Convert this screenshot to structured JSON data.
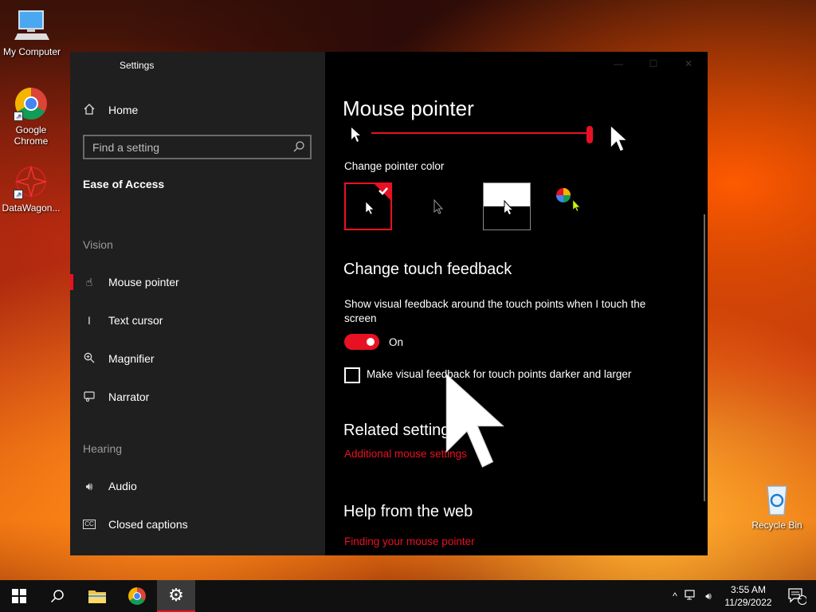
{
  "desktop": {
    "icons": [
      {
        "label": "My Computer"
      },
      {
        "label": "Google Chrome"
      },
      {
        "label": "DataWagon..."
      },
      {
        "label": "Recycle Bin"
      }
    ]
  },
  "window": {
    "title": "Settings",
    "sidebar": {
      "home": "Home",
      "search_placeholder": "Find a setting",
      "category": "Ease of Access",
      "vision_label": "Vision",
      "hearing_label": "Hearing",
      "items": [
        {
          "label": "Mouse pointer",
          "icon": "mouse-pointer-icon"
        },
        {
          "label": "Text cursor",
          "icon": "text-cursor-icon"
        },
        {
          "label": "Magnifier",
          "icon": "magnifier-icon"
        },
        {
          "label": "Narrator",
          "icon": "narrator-icon"
        },
        {
          "label": "Audio",
          "icon": "speaker-icon"
        },
        {
          "label": "Closed captions",
          "icon": "cc-icon"
        }
      ]
    },
    "main": {
      "title": "Mouse pointer",
      "pointer_size_level": 1.0,
      "change_color_label": "Change pointer color",
      "selected_color_option": 0,
      "touch_heading": "Change touch feedback",
      "touch_desc": "Show visual feedback around the touch points when I touch the screen",
      "toggle_state": "On",
      "checkbox_label": "Make visual feedback for touch points darker and larger",
      "related_heading": "Related settings",
      "related_link": "Additional mouse settings",
      "help_heading": "Help from the web",
      "help_link": "Finding your mouse pointer"
    },
    "accent_color": "#e81123"
  },
  "taskbar": {
    "time": "3:55 AM",
    "date": "11/29/2022",
    "notification_count": "1"
  }
}
